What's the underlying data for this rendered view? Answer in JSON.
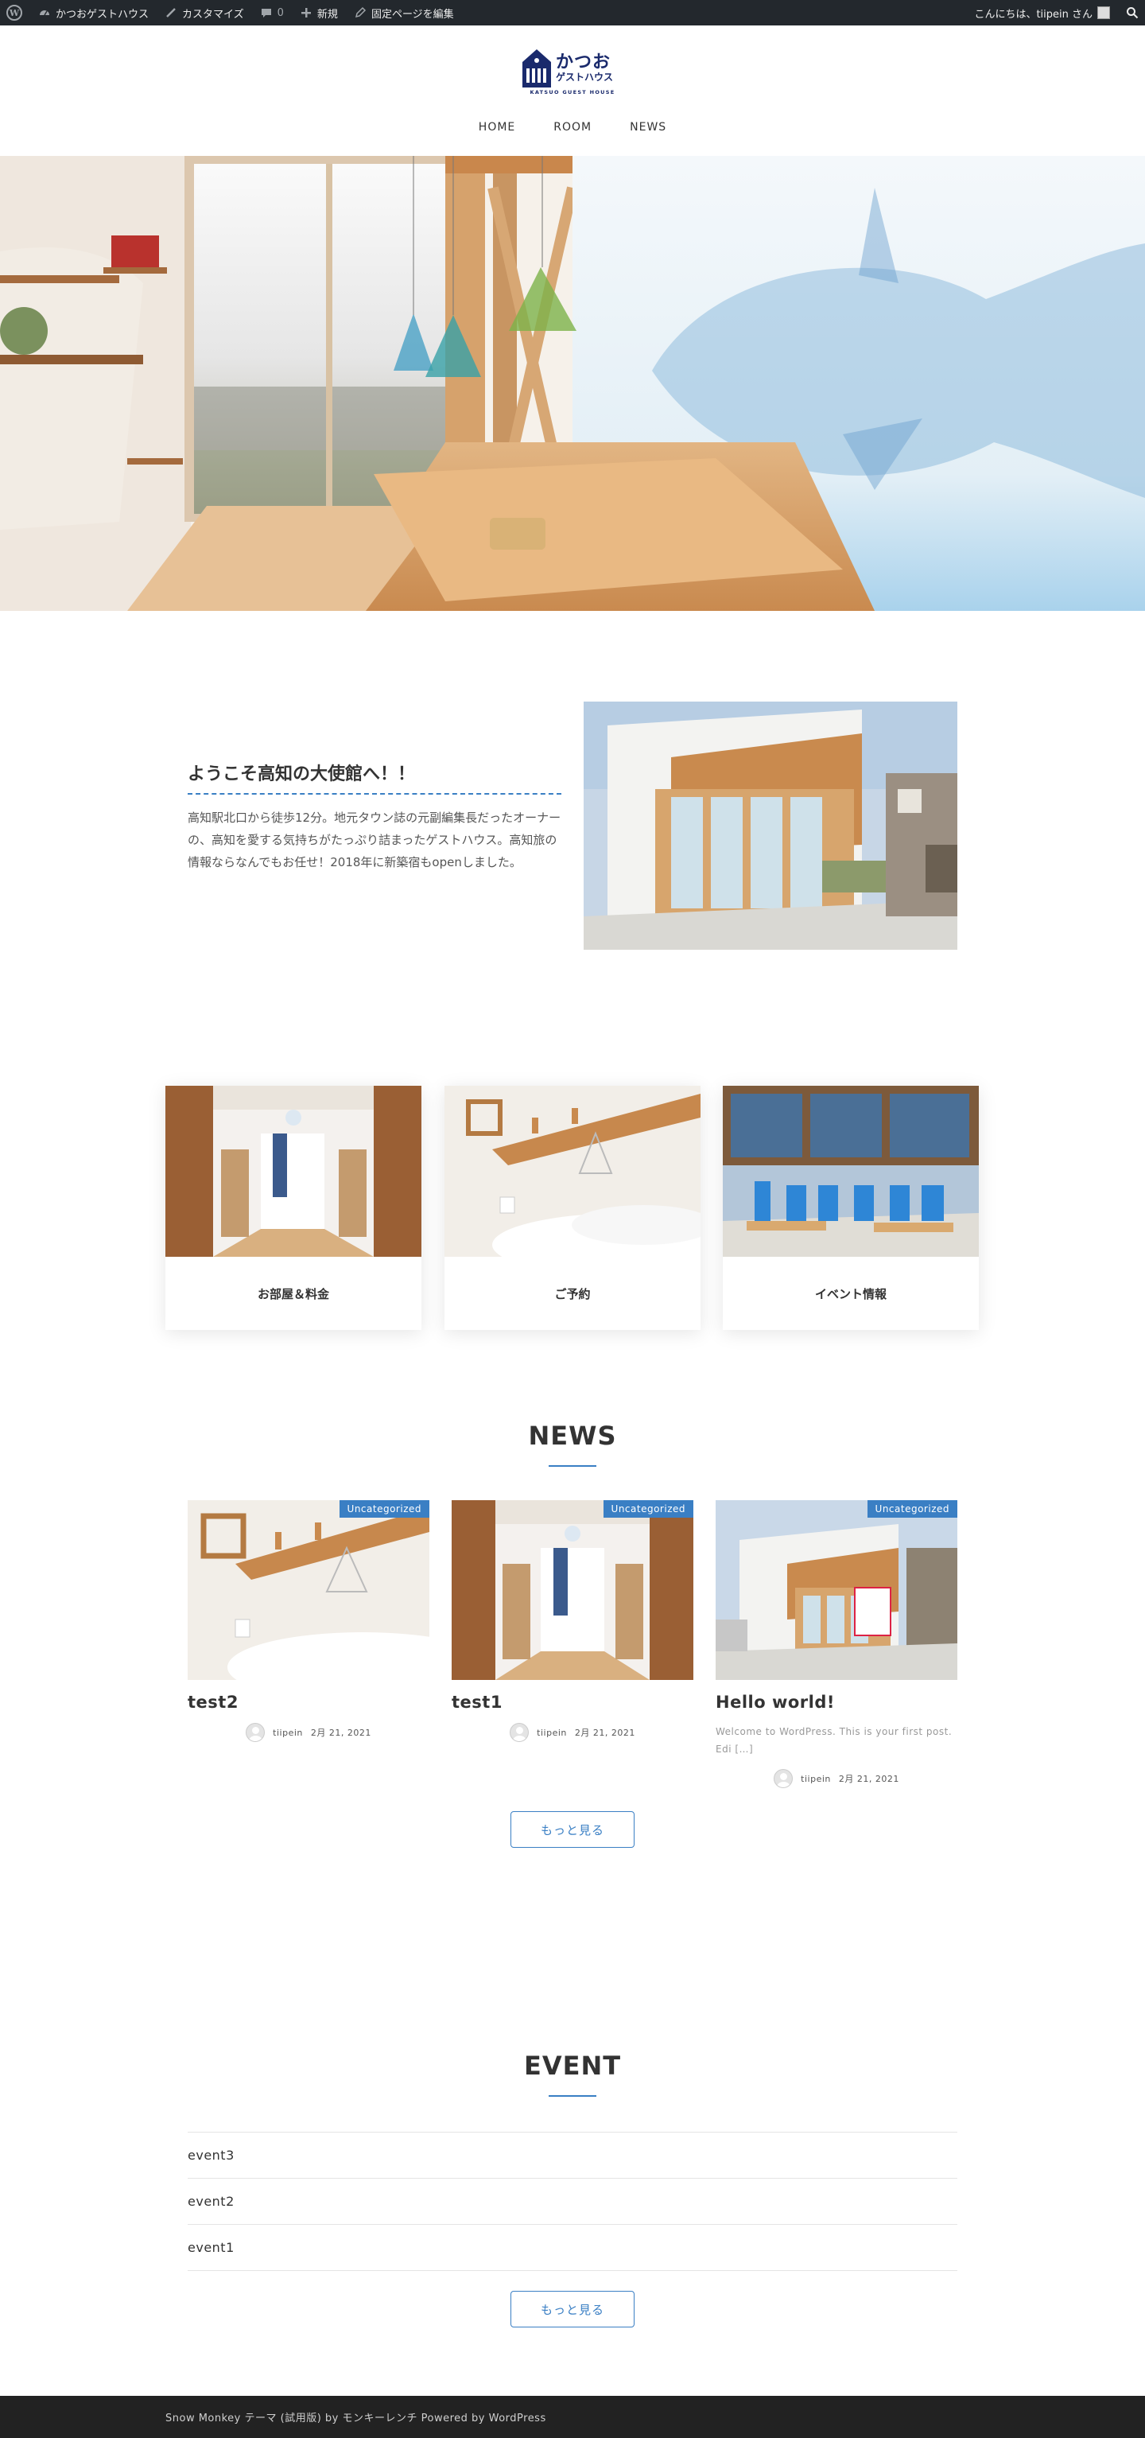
{
  "adminbar": {
    "wp_logo": "wordpress-icon",
    "site_name": "かつおゲストハウス",
    "customize": "カスタマイズ",
    "comments_count": "0",
    "new": "新規",
    "edit_page": "固定ページを編集",
    "greeting": "こんにちは、tiipein さん"
  },
  "header": {
    "logo_title": "かつお",
    "logo_sub": "ゲストハウス",
    "logo_en": "KATSUO GUEST HOUSE",
    "nav": [
      "HOME",
      "ROOM",
      "NEWS"
    ]
  },
  "welcome": {
    "title": "ようこそ高知の大使館へ！！",
    "text": "高知駅北口から徒歩12分。地元タウン誌の元副編集長だったオーナーの、高知を愛する気持ちがたっぷり詰まったゲストハウス。高知旅の情報ならなんでもお任せ！2018年に新築宿もopenしました。"
  },
  "cards": [
    "お部屋＆料金",
    "ご予約",
    "イベント情報"
  ],
  "news": {
    "title": "NEWS",
    "items": [
      {
        "category": "Uncategorized",
        "title": "test2",
        "excerpt": "",
        "author": "tiipein",
        "date": "2月 21, 2021"
      },
      {
        "category": "Uncategorized",
        "title": "test1",
        "excerpt": "",
        "author": "tiipein",
        "date": "2月 21, 2021"
      },
      {
        "category": "Uncategorized",
        "title": "Hello world!",
        "excerpt": "Welcome to WordPress. This is your first post. Edi [&hellip;]",
        "author": "tiipein",
        "date": "2月 21, 2021"
      }
    ],
    "more": "もっと見る"
  },
  "event": {
    "title": "EVENT",
    "items": [
      "event3",
      "event2",
      "event1"
    ],
    "more": "もっと見る"
  },
  "footer": {
    "text": "Snow Monkey テーマ (試用版) by モンキーレンチ Powered by WordPress"
  },
  "colors": {
    "accent": "#3a7fc4",
    "brand_navy": "#1a2a6c",
    "adminbar": "#23282d",
    "footer": "#222222"
  }
}
